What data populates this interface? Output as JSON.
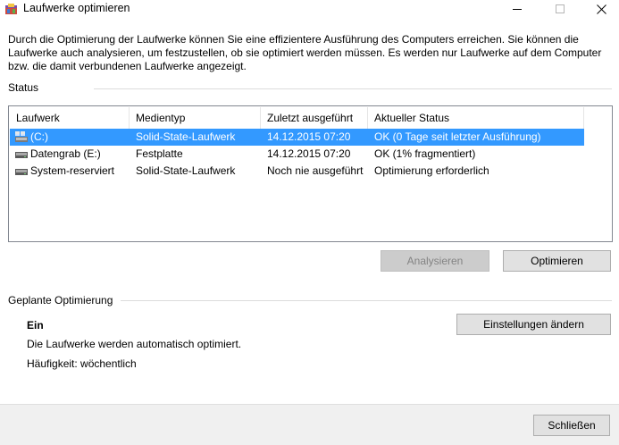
{
  "window": {
    "title": "Laufwerke optimieren",
    "icons": {
      "app": "defrag-app-icon",
      "minimize": "minimize-icon",
      "maximize": "maximize-icon",
      "close": "close-icon"
    }
  },
  "intro_text": "Durch die Optimierung der Laufwerke können Sie eine effizientere Ausführung des Computers erreichen. Sie können die Laufwerke auch analysieren, um festzustellen, ob sie optimiert werden müssen. Es werden nur Laufwerke auf dem Computer bzw. die damit verbundenen Laufwerke angezeigt.",
  "status": {
    "label": "Status",
    "columns": [
      "Laufwerk",
      "Medientyp",
      "Zuletzt ausgeführt",
      "Aktueller Status"
    ],
    "rows": [
      {
        "drive": "(C:)",
        "media": "Solid-State-Laufwerk",
        "last_run": "14.12.2015 07:20",
        "status": "OK (0 Tage seit letzter Ausführung)",
        "icon": "windows-drive-icon",
        "selected": true
      },
      {
        "drive": "Datengrab (E:)",
        "media": "Festplatte",
        "last_run": "14.12.2015 07:20",
        "status": "OK (1% fragmentiert)",
        "icon": "hard-drive-icon",
        "selected": false
      },
      {
        "drive": "System-reserviert",
        "media": "Solid-State-Laufwerk",
        "last_run": "Noch nie ausgeführt",
        "status": "Optimierung erforderlich",
        "icon": "hard-drive-icon",
        "selected": false
      }
    ]
  },
  "buttons": {
    "analyze": "Analysieren",
    "optimize": "Optimieren",
    "change_settings": "Einstellungen ändern",
    "close": "Schließen"
  },
  "scheduled": {
    "label": "Geplante Optimierung",
    "state": "Ein",
    "description": "Die Laufwerke werden automatisch optimiert.",
    "frequency": "Häufigkeit: wöchentlich"
  },
  "colors": {
    "selection": "#3399ff",
    "button_face": "#e1e1e1",
    "footer": "#f0f0f0"
  }
}
